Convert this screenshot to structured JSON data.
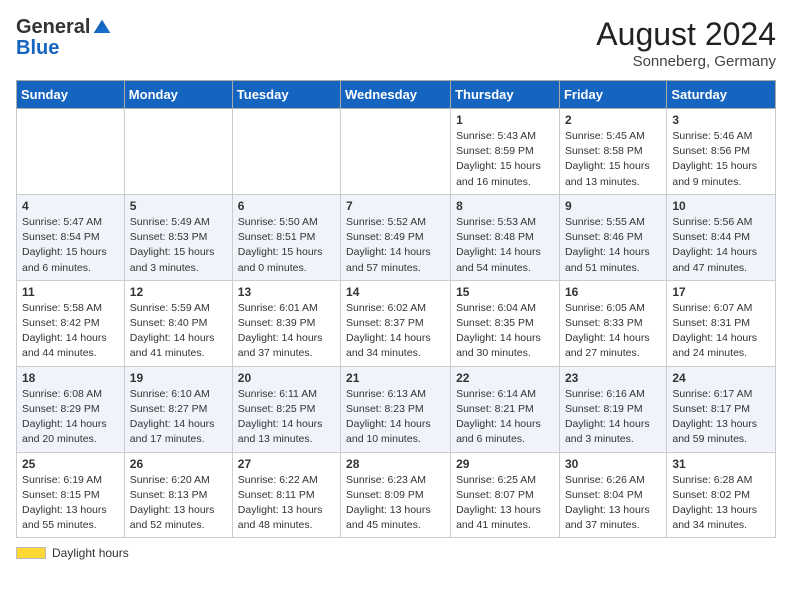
{
  "header": {
    "logo_general": "General",
    "logo_blue": "Blue",
    "month_year": "August 2024",
    "location": "Sonneberg, Germany"
  },
  "calendar": {
    "days_of_week": [
      "Sunday",
      "Monday",
      "Tuesday",
      "Wednesday",
      "Thursday",
      "Friday",
      "Saturday"
    ],
    "weeks": [
      [
        {
          "day": "",
          "info": ""
        },
        {
          "day": "",
          "info": ""
        },
        {
          "day": "",
          "info": ""
        },
        {
          "day": "",
          "info": ""
        },
        {
          "day": "1",
          "info": "Sunrise: 5:43 AM\nSunset: 8:59 PM\nDaylight: 15 hours and 16 minutes."
        },
        {
          "day": "2",
          "info": "Sunrise: 5:45 AM\nSunset: 8:58 PM\nDaylight: 15 hours and 13 minutes."
        },
        {
          "day": "3",
          "info": "Sunrise: 5:46 AM\nSunset: 8:56 PM\nDaylight: 15 hours and 9 minutes."
        }
      ],
      [
        {
          "day": "4",
          "info": "Sunrise: 5:47 AM\nSunset: 8:54 PM\nDaylight: 15 hours and 6 minutes."
        },
        {
          "day": "5",
          "info": "Sunrise: 5:49 AM\nSunset: 8:53 PM\nDaylight: 15 hours and 3 minutes."
        },
        {
          "day": "6",
          "info": "Sunrise: 5:50 AM\nSunset: 8:51 PM\nDaylight: 15 hours and 0 minutes."
        },
        {
          "day": "7",
          "info": "Sunrise: 5:52 AM\nSunset: 8:49 PM\nDaylight: 14 hours and 57 minutes."
        },
        {
          "day": "8",
          "info": "Sunrise: 5:53 AM\nSunset: 8:48 PM\nDaylight: 14 hours and 54 minutes."
        },
        {
          "day": "9",
          "info": "Sunrise: 5:55 AM\nSunset: 8:46 PM\nDaylight: 14 hours and 51 minutes."
        },
        {
          "day": "10",
          "info": "Sunrise: 5:56 AM\nSunset: 8:44 PM\nDaylight: 14 hours and 47 minutes."
        }
      ],
      [
        {
          "day": "11",
          "info": "Sunrise: 5:58 AM\nSunset: 8:42 PM\nDaylight: 14 hours and 44 minutes."
        },
        {
          "day": "12",
          "info": "Sunrise: 5:59 AM\nSunset: 8:40 PM\nDaylight: 14 hours and 41 minutes."
        },
        {
          "day": "13",
          "info": "Sunrise: 6:01 AM\nSunset: 8:39 PM\nDaylight: 14 hours and 37 minutes."
        },
        {
          "day": "14",
          "info": "Sunrise: 6:02 AM\nSunset: 8:37 PM\nDaylight: 14 hours and 34 minutes."
        },
        {
          "day": "15",
          "info": "Sunrise: 6:04 AM\nSunset: 8:35 PM\nDaylight: 14 hours and 30 minutes."
        },
        {
          "day": "16",
          "info": "Sunrise: 6:05 AM\nSunset: 8:33 PM\nDaylight: 14 hours and 27 minutes."
        },
        {
          "day": "17",
          "info": "Sunrise: 6:07 AM\nSunset: 8:31 PM\nDaylight: 14 hours and 24 minutes."
        }
      ],
      [
        {
          "day": "18",
          "info": "Sunrise: 6:08 AM\nSunset: 8:29 PM\nDaylight: 14 hours and 20 minutes."
        },
        {
          "day": "19",
          "info": "Sunrise: 6:10 AM\nSunset: 8:27 PM\nDaylight: 14 hours and 17 minutes."
        },
        {
          "day": "20",
          "info": "Sunrise: 6:11 AM\nSunset: 8:25 PM\nDaylight: 14 hours and 13 minutes."
        },
        {
          "day": "21",
          "info": "Sunrise: 6:13 AM\nSunset: 8:23 PM\nDaylight: 14 hours and 10 minutes."
        },
        {
          "day": "22",
          "info": "Sunrise: 6:14 AM\nSunset: 8:21 PM\nDaylight: 14 hours and 6 minutes."
        },
        {
          "day": "23",
          "info": "Sunrise: 6:16 AM\nSunset: 8:19 PM\nDaylight: 14 hours and 3 minutes."
        },
        {
          "day": "24",
          "info": "Sunrise: 6:17 AM\nSunset: 8:17 PM\nDaylight: 13 hours and 59 minutes."
        }
      ],
      [
        {
          "day": "25",
          "info": "Sunrise: 6:19 AM\nSunset: 8:15 PM\nDaylight: 13 hours and 55 minutes."
        },
        {
          "day": "26",
          "info": "Sunrise: 6:20 AM\nSunset: 8:13 PM\nDaylight: 13 hours and 52 minutes."
        },
        {
          "day": "27",
          "info": "Sunrise: 6:22 AM\nSunset: 8:11 PM\nDaylight: 13 hours and 48 minutes."
        },
        {
          "day": "28",
          "info": "Sunrise: 6:23 AM\nSunset: 8:09 PM\nDaylight: 13 hours and 45 minutes."
        },
        {
          "day": "29",
          "info": "Sunrise: 6:25 AM\nSunset: 8:07 PM\nDaylight: 13 hours and 41 minutes."
        },
        {
          "day": "30",
          "info": "Sunrise: 6:26 AM\nSunset: 8:04 PM\nDaylight: 13 hours and 37 minutes."
        },
        {
          "day": "31",
          "info": "Sunrise: 6:28 AM\nSunset: 8:02 PM\nDaylight: 13 hours and 34 minutes."
        }
      ]
    ]
  },
  "footer": {
    "daylight_label": "Daylight hours"
  }
}
